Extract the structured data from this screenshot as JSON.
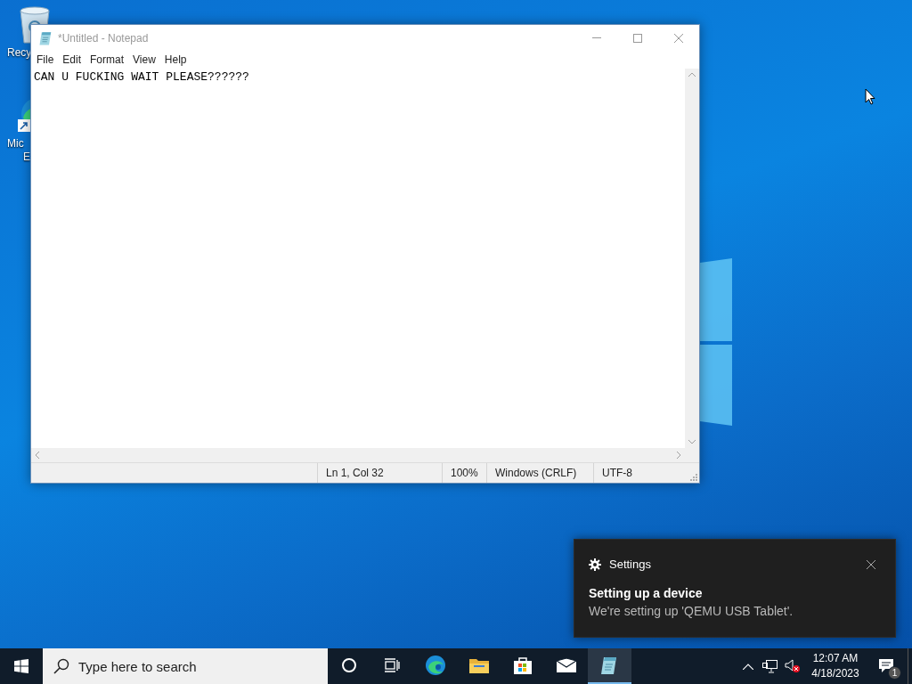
{
  "desktop_icons": [
    {
      "kind": "recycle-bin",
      "lines": [
        "Recy"
      ]
    },
    {
      "kind": "edge",
      "lines": [
        "Mic",
        "E"
      ]
    }
  ],
  "notepad": {
    "title": "*Untitled - Notepad",
    "menu": [
      "File",
      "Edit",
      "Format",
      "View",
      "Help"
    ],
    "text": "CAN U FUCKING WAIT PLEASE??????",
    "status": [
      "Ln 1, Col 32",
      "100%",
      "Windows (CRLF)",
      "UTF-8"
    ]
  },
  "toast": {
    "app": "Settings",
    "title": "Setting up a device",
    "body": "We're setting up 'QEMU USB Tablet'."
  },
  "taskbar": {
    "search": {
      "placeholder": "Type here to search"
    },
    "apps": [
      {
        "kind": "cortana",
        "active": false
      },
      {
        "kind": "task-view",
        "active": false
      },
      {
        "kind": "edge",
        "active": false
      },
      {
        "kind": "explorer",
        "active": false
      },
      {
        "kind": "store",
        "active": false
      },
      {
        "kind": "mail",
        "active": false
      },
      {
        "kind": "notepad",
        "active": true
      }
    ],
    "time": "12:07 AM",
    "date": "4/18/2023",
    "notification_count": "1"
  }
}
